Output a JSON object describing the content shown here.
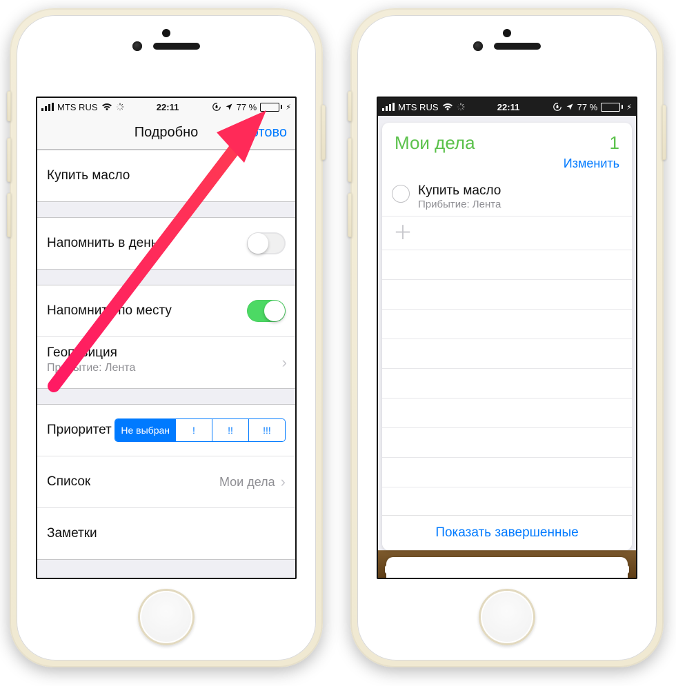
{
  "status": {
    "carrier": "MTS RUS",
    "time": "22:11",
    "battery_text": "77 %"
  },
  "detail": {
    "nav_title": "Подробно",
    "done": "Готово",
    "name": "Купить масло",
    "remind_day": "Напомнить в день",
    "remind_location": "Напомнить по месту",
    "location_label": "Геопозиция",
    "location_value": "Прибытие: Лента",
    "priority_label": "Приоритет",
    "priority_options": [
      "Не выбран",
      "!",
      "!!",
      "!!!"
    ],
    "list_label": "Список",
    "list_value": "Мои дела",
    "notes_label": "Заметки"
  },
  "list": {
    "title": "Мои дела",
    "count": "1",
    "edit": "Изменить",
    "item_title": "Купить масло",
    "item_sub": "Прибытие: Лента",
    "show_completed": "Показать завершенные"
  }
}
